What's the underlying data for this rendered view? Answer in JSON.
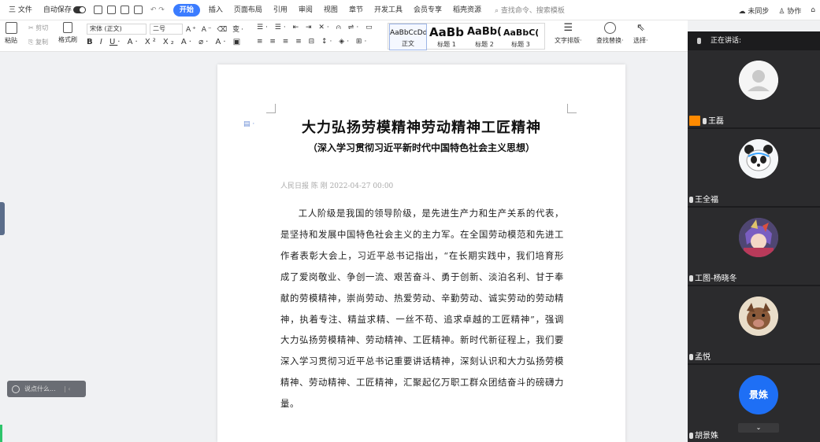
{
  "menubar": {
    "menu_label": "三 文件",
    "autosave_label": "自动保存",
    "tabs": [
      "开始",
      "插入",
      "页面布局",
      "引用",
      "审阅",
      "视图",
      "章节",
      "开发工具",
      "会员专享",
      "稻壳资源"
    ],
    "active_tab": "开始",
    "search_text": "查找命令、搜索模板",
    "unsync_label": "未同步",
    "collab_label": "协作"
  },
  "ribbon": {
    "paste_label": "粘贴",
    "cut_label": "剪切",
    "copy_label": "复制",
    "format_painter_label": "格式刷",
    "font_name": "宋体 (正文)",
    "font_size": "二号",
    "styles": [
      {
        "sample": "AaBbCcDd",
        "name": "正文"
      },
      {
        "sample": "AaBb",
        "name": "标题 1"
      },
      {
        "sample": "AaBb(",
        "name": "标题 2"
      },
      {
        "sample": "AaBbC(",
        "name": "标题 3"
      }
    ],
    "text_layout_label": "文字排版",
    "find_replace_label": "查找替换",
    "select_label": "选择"
  },
  "document": {
    "title": "大力弘扬劳模精神劳动精神工匠精神",
    "subtitle": "（深入学习贯彻习近平新时代中国特色社会主义思想）",
    "meta": "人民日报  陈 刚 2022-04-27 00:00",
    "body": "工人阶级是我国的领导阶级，是先进生产力和生产关系的代表，是坚持和发展中国特色社会主义的主力军。在全国劳动模范和先进工作者表彰大会上，习近平总书记指出，“在长期实践中，我们培育形成了爱岗敬业、争创一流、艰苦奋斗、勇于创新、淡泊名利、甘于奉献的劳模精神，崇尚劳动、热爱劳动、辛勤劳动、诚实劳动的劳动精神，执着专注、精益求精、一丝不苟、追求卓越的工匠精神”，强调大力弘扬劳模精神、劳动精神、工匠精神。新时代新征程上，我们要深入学习贯彻习近平总书记重要讲话精神，深刻认识和大力弘扬劳模精神、劳动精神、工匠精神，汇聚起亿万职工群众团结奋斗的磅礴力量。"
  },
  "comment_box": {
    "placeholder": "说点什么..."
  },
  "meeting": {
    "speaking_label": "正在讲话:",
    "participants": [
      {
        "name": "王磊",
        "avatar": "default-person-icon",
        "host": true
      },
      {
        "name": "王全福",
        "avatar": "panda-avatar-icon",
        "host": false
      },
      {
        "name": "工图-杨晓冬",
        "avatar": "anime-avatar-icon",
        "host": false
      },
      {
        "name": "孟悦",
        "avatar": "animal-avatar-icon",
        "host": false
      },
      {
        "name": "胡景姝",
        "avatar_text": "景姝",
        "host": false
      }
    ]
  },
  "colors": {
    "accent": "#3b7cff",
    "panel_bg": "#1c1c1e",
    "host_badge": "#ff8a00",
    "avatar_blue": "#1e6ff5"
  }
}
